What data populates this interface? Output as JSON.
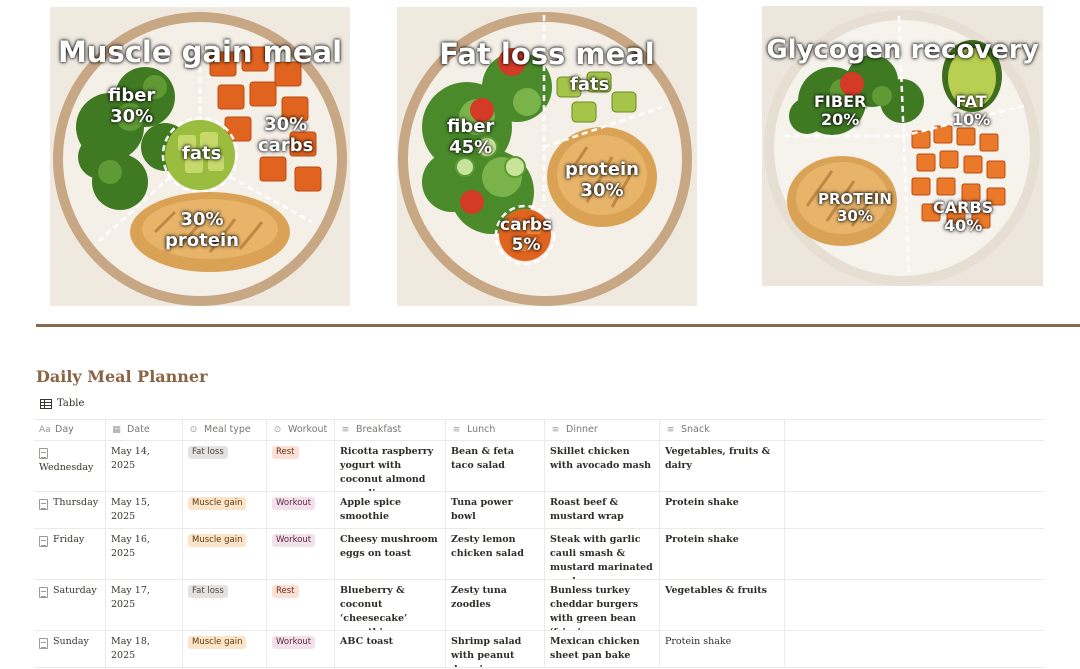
{
  "plates": [
    {
      "title": "Muscle gain meal",
      "segments": [
        {
          "name": "fiber",
          "value": "30%"
        },
        {
          "name": "30%",
          "value": "carbs"
        },
        {
          "name": "fats",
          "value": ""
        },
        {
          "name": "30%",
          "value": "protein"
        }
      ]
    },
    {
      "title": "Fat loss meal",
      "segments": [
        {
          "name": "fats",
          "value": ""
        },
        {
          "name": "fiber",
          "value": "45%"
        },
        {
          "name": "protein",
          "value": "30%"
        },
        {
          "name": "carbs",
          "value": "5%"
        }
      ]
    },
    {
      "title": "Glycogen recovery",
      "segments": [
        {
          "name": "FIBER",
          "value": "20%"
        },
        {
          "name": "FAT",
          "value": "10%"
        },
        {
          "name": "PROTEIN",
          "value": "30%"
        },
        {
          "name": "CARBS",
          "value": "40%"
        }
      ]
    }
  ],
  "planner": {
    "title": "Daily Meal Planner",
    "view_tab": "Table",
    "columns": [
      "Day",
      "Date",
      "Meal type",
      "Workout",
      "Breakfast",
      "Lunch",
      "Dinner",
      "Snack"
    ],
    "rows": [
      {
        "day": "Wednesday",
        "date": "May 14, 2025",
        "meal_type": "Fat loss",
        "workout": "Rest",
        "breakfast": "Ricotta raspberry yogurt with coconut almond muesli",
        "lunch": "Bean & feta taco salad",
        "dinner": "Skillet chicken with avocado mash",
        "snack": "Vegetables, fruits & dairy"
      },
      {
        "day": "Thursday",
        "date": "May 15, 2025",
        "meal_type": "Muscle gain",
        "workout": "Workout",
        "breakfast": "Apple spice smoothie",
        "lunch": "Tuna power bowl",
        "dinner": "Roast beef & mustard wrap",
        "snack": "Protein shake"
      },
      {
        "day": "Friday",
        "date": "May 16, 2025",
        "meal_type": "Muscle gain",
        "workout": "Workout",
        "breakfast": "Cheesy mushroom eggs on toast",
        "lunch": "Zesty lemon chicken salad",
        "dinner": "Steak with garlic cauli smash & mustard marinated mushrooms",
        "snack": "Protein shake"
      },
      {
        "day": "Saturday",
        "date": "May 17, 2025",
        "meal_type": "Fat loss",
        "workout": "Rest",
        "breakfast": "Blueberry & coconut ‘cheesecake’ smoothie",
        "lunch": "Zesty tuna zoodles",
        "dinner": "Bunless turkey cheddar burgers with green bean ‘fries’",
        "snack": "Vegetables & fruits"
      },
      {
        "day": "Sunday",
        "date": "May 18, 2025",
        "meal_type": "Muscle gain",
        "workout": "Workout",
        "breakfast": "ABC toast",
        "lunch": "Shrimp salad with peanut dressing",
        "dinner": "Mexican chicken sheet pan bake",
        "snack": "Protein shake"
      }
    ]
  },
  "colors": {
    "divider": "#8a6a4c",
    "planner_title": "#8a6244",
    "tag_fat_loss": "#e3e2e0",
    "tag_muscle_gain": "#fbe4c8",
    "tag_rest": "#fbe0d6",
    "tag_workout": "#f3e1ea"
  }
}
